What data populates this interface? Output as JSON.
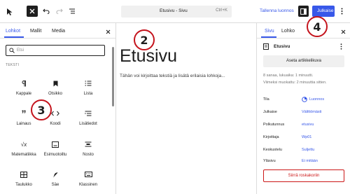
{
  "topbar": {
    "document_title": "Etusivu - Sivu",
    "shortcut": "Ctrl+K",
    "save_draft_label": "Tallenna luonnos",
    "publish_label": "Julkaise"
  },
  "inserter": {
    "tabs": [
      "Lohkot",
      "Mallit",
      "Media"
    ],
    "search_placeholder": "Etsi",
    "section_label": "TEKSTI",
    "blocks": [
      "Kappale",
      "Otsikko",
      "Lista",
      "Lainaus",
      "Koodi",
      "Lisätiedot",
      "Matematiikka",
      "Esimuotoiltu",
      "Nosto",
      "Taulukko",
      "Säe",
      "Klassinen"
    ]
  },
  "editor": {
    "page_title": "Etusivu",
    "body_text": "Tähän voi kirjoittaa tekstiä ja lisätä erilaisia lohkoja..."
  },
  "settings": {
    "tabs": [
      "Sivu",
      "Lohko"
    ],
    "page_name": "Etusivu",
    "featured_image_label": "Aseta artikkelikuva",
    "meta_line1": "8 sanaa, lukuaika: 1 minuutti.",
    "meta_line2": "Viimeksi muokattu: 2 minuuttia sitten.",
    "rows": [
      {
        "label": "Tila",
        "value": "Luonnos"
      },
      {
        "label": "Julkaise",
        "value": "Välittömästi"
      },
      {
        "label": "Polkutunnus",
        "value": "etusivu"
      },
      {
        "label": "Kirjoittaja",
        "value": "Wp01"
      },
      {
        "label": "Keskustelu",
        "value": "Suljettu"
      },
      {
        "label": "Yläsivu",
        "value": "Ei mitään"
      }
    ],
    "trash_label": "Siirrä roskakoriin"
  },
  "annotations": [
    "2",
    "3",
    "4"
  ],
  "colors": {
    "accent": "#3858e9",
    "danger": "#cc1818",
    "annotation_ring": "#c4131c"
  }
}
